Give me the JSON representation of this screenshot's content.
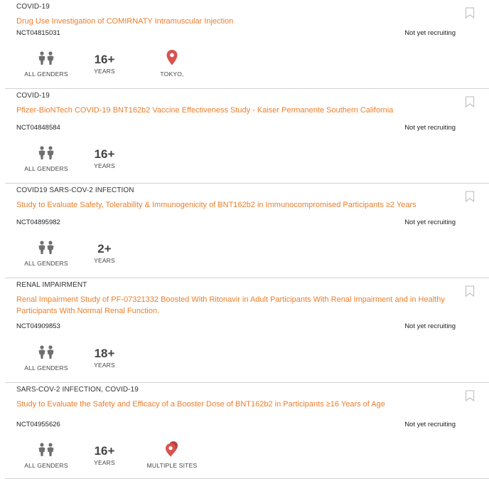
{
  "colors": {
    "accent": "#ee7d2a",
    "pin": "#d9534f",
    "icon": "#6f6f6f",
    "divider": "#d4d4d4"
  },
  "icons": {
    "gender": "people-icon",
    "location": "map-pin-icon",
    "multi_location": "multiple-pins-icon",
    "bookmark": "bookmark-icon"
  },
  "trials": [
    {
      "condition": "COVID-19",
      "title": "Drug Use Investigation of COMIRNATY Intramuscular Injection",
      "nct": "NCT04815031",
      "status": "Not yet recruiting",
      "gender": "ALL GENDERS",
      "age": "16+",
      "age_unit": "YEARS",
      "location": "TOKYO,",
      "location_icon": "single"
    },
    {
      "condition": "COVID-19",
      "title": "Pfizer-BioNTech COVID-19 BNT162b2 Vaccine Effectiveness Study - Kaiser Permanente Southern California",
      "nct": "NCT04848584",
      "status": "Not yet recruiting",
      "gender": "ALL GENDERS",
      "age": "16+",
      "age_unit": "YEARS",
      "location": "",
      "location_icon": "none"
    },
    {
      "condition": "COVID19 SARS-COV-2 INFECTION",
      "title": "Study to Evaluate Safety, Tolerability & Immunogenicity of BNT162b2 in Immunocompromised Participants ≥2 Years",
      "nct": "NCT04895982",
      "status": "Not yet recruiting",
      "gender": "ALL GENDERS",
      "age": "2+",
      "age_unit": "YEARS",
      "location": "",
      "location_icon": "none"
    },
    {
      "condition": "RENAL IMPAIRMENT",
      "title": "Renal Impairment Study of PF-07321332 Boosted With Ritonavir in Adult Participants With Renal Impairment and in Healthy Participants With Normal Renal Function.",
      "nct": "NCT04909853",
      "status": "Not yet recruiting",
      "gender": "ALL GENDERS",
      "age": "18+",
      "age_unit": "YEARS",
      "location": "",
      "location_icon": "none"
    },
    {
      "condition": "SARS-COV-2 INFECTION, COVID-19",
      "title": "Study to Evaluate the Safety and Efficacy of a Booster Dose of BNT162b2 in Participants ≥16 Years of Age",
      "nct": "NCT04955626",
      "status": "Not yet recruiting",
      "gender": "ALL GENDERS",
      "age": "16+",
      "age_unit": "YEARS",
      "location": "MULTIPLE SITES",
      "location_icon": "multi"
    }
  ]
}
